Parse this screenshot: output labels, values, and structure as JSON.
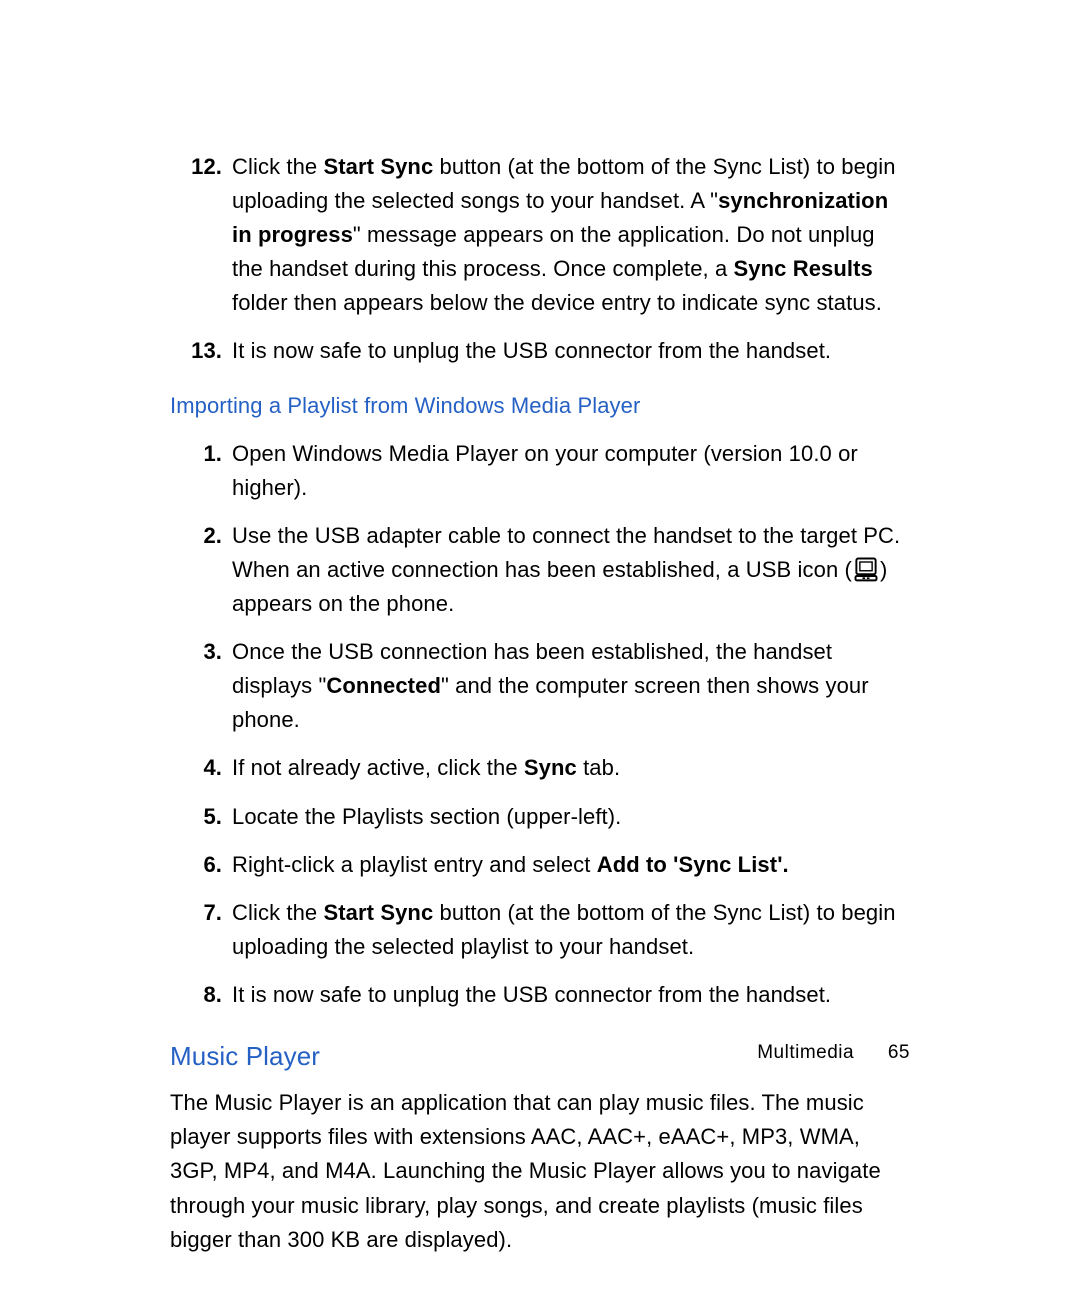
{
  "stepsA": [
    {
      "num": "12.",
      "parts": [
        {
          "t": "Click the "
        },
        {
          "t": "Start Sync",
          "b": true
        },
        {
          "t": " button (at the bottom of the Sync List) to begin uploading the selected songs to your handset. A \""
        },
        {
          "t": "synchronization in progress",
          "b": true
        },
        {
          "t": "\" message appears on the application. Do not unplug the handset during this process. Once complete, a "
        },
        {
          "t": "Sync Results",
          "b": true
        },
        {
          "t": " folder then appears below the device entry to indicate sync status."
        }
      ]
    },
    {
      "num": "13.",
      "parts": [
        {
          "t": "It is now safe to unplug the USB connector from the handset."
        }
      ]
    }
  ],
  "subheading": "Importing a Playlist from Windows Media Player",
  "stepsB": [
    {
      "num": "1.",
      "parts": [
        {
          "t": "Open Windows Media Player on your computer (version 10.0 or higher)."
        }
      ]
    },
    {
      "num": "2.",
      "parts": [
        {
          "t": "Use the USB adapter cable to connect the handset to the target PC. When an active connection has been established, a USB icon ("
        },
        {
          "icon": true
        },
        {
          "t": ") appears on the phone."
        }
      ]
    },
    {
      "num": "3.",
      "parts": [
        {
          "t": "Once the USB connection has been established, the handset displays \""
        },
        {
          "t": "Connected",
          "b": true
        },
        {
          "t": "\" and the computer screen then shows your phone."
        }
      ]
    },
    {
      "num": "4.",
      "parts": [
        {
          "t": "If not already active, click the "
        },
        {
          "t": "Sync",
          "b": true
        },
        {
          "t": " tab."
        }
      ]
    },
    {
      "num": "5.",
      "parts": [
        {
          "t": "Locate the Playlists section (upper-left)."
        }
      ]
    },
    {
      "num": "6.",
      "parts": [
        {
          "t": "Right-click a playlist entry and select "
        },
        {
          "t": "Add to 'Sync List'.",
          "b": true
        }
      ]
    },
    {
      "num": "7.",
      "parts": [
        {
          "t": "Click the "
        },
        {
          "t": "Start Sync",
          "b": true
        },
        {
          "t": " button (at the bottom of the Sync List) to begin uploading the selected playlist to your handset."
        }
      ]
    },
    {
      "num": "8.",
      "parts": [
        {
          "t": "It is now safe to unplug the USB connector from the handset."
        }
      ]
    }
  ],
  "sectionHeading": "Music Player",
  "paragraph": "The Music Player is an application that can play music files. The music player supports files with extensions AAC, AAC+, eAAC+, MP3, WMA, 3GP, MP4, and M4A. Launching the Music Player allows you to navigate through your music library, play songs, and create playlists (music files bigger than 300 KB are displayed).",
  "footer": {
    "section": "Multimedia",
    "page": "65"
  }
}
